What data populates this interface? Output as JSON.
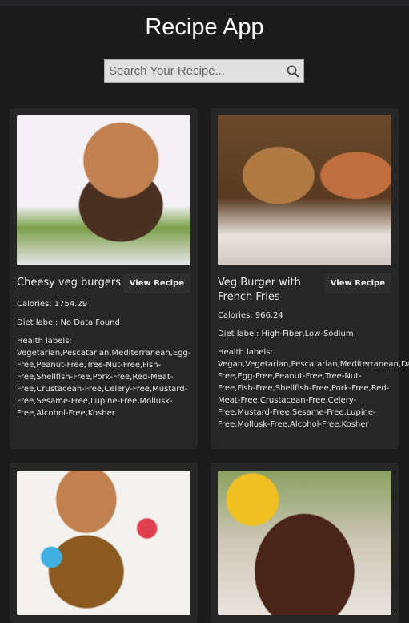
{
  "app": {
    "title": "Recipe App"
  },
  "search": {
    "placeholder": "Search Your Recipe...",
    "icon": "search-icon"
  },
  "recipes": [
    {
      "title": "Cheesy veg burgers",
      "button": "View Recipe",
      "calories": "Calories: 1754.29",
      "diet": "Diet label: No Data Found",
      "health_heading": "Health labels:",
      "health": "Vegetarian,Pescatarian,Mediterranean,Egg-Free,Peanut-Free,Tree-Nut-Free,Fish-Free,Shellfish-Free,Pork-Free,Red-Meat-Free,Crustacean-Free,Celery-Free,Mustard-Free,Sesame-Free,Lupine-Free,Mollusk-Free,Alcohol-Free,Kosher"
    },
    {
      "title": "Veg Burger with French Fries",
      "button": "View Recipe",
      "calories": "Calories: 966.24",
      "diet": "Diet label: High-Fiber,Low-Sodium",
      "health_heading": "Health labels:",
      "health": "Vegan,Vegetarian,Pescatarian,Mediterranean,Dairy-Free,Egg-Free,Peanut-Free,Tree-Nut-Free,Fish-Free,Shellfish-Free,Pork-Free,Red-Meat-Free,Crustacean-Free,Celery-Free,Mustard-Free,Sesame-Free,Lupine-Free,Mollusk-Free,Alcohol-Free,Kosher"
    }
  ]
}
